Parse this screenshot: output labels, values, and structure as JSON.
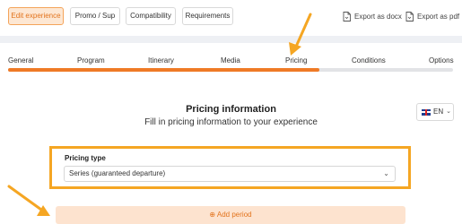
{
  "toolbar": {
    "tabs": [
      {
        "label": "Edit experience",
        "active": true
      },
      {
        "label": "Promo / Sup",
        "active": false
      },
      {
        "label": "Compatibility",
        "active": false
      },
      {
        "label": "Requirements",
        "active": false
      }
    ],
    "export_docx": "Export as docx",
    "export_pdf": "Export as pdf",
    "export_icon": "document-icon"
  },
  "steps": {
    "items": [
      "General",
      "Program",
      "Itinerary",
      "Media",
      "Pricing",
      "Conditions",
      "Options"
    ],
    "current": "Pricing",
    "progress": 0.7
  },
  "main": {
    "title": "Pricing information",
    "subtitle": "Fill in pricing information to your experience",
    "language": "EN",
    "language_flag": "uk-flag-icon",
    "pricing_type_label": "Pricing type",
    "pricing_type_value": "Series (guaranteed departure)",
    "add_period_label": "Add period",
    "add_period_icon": "plus-circle-icon"
  },
  "colors": {
    "accent": "#ef7a26",
    "highlight": "#f5a623",
    "active_tab_bg": "#fde7d3",
    "add_period_bg": "#fde3cf"
  }
}
